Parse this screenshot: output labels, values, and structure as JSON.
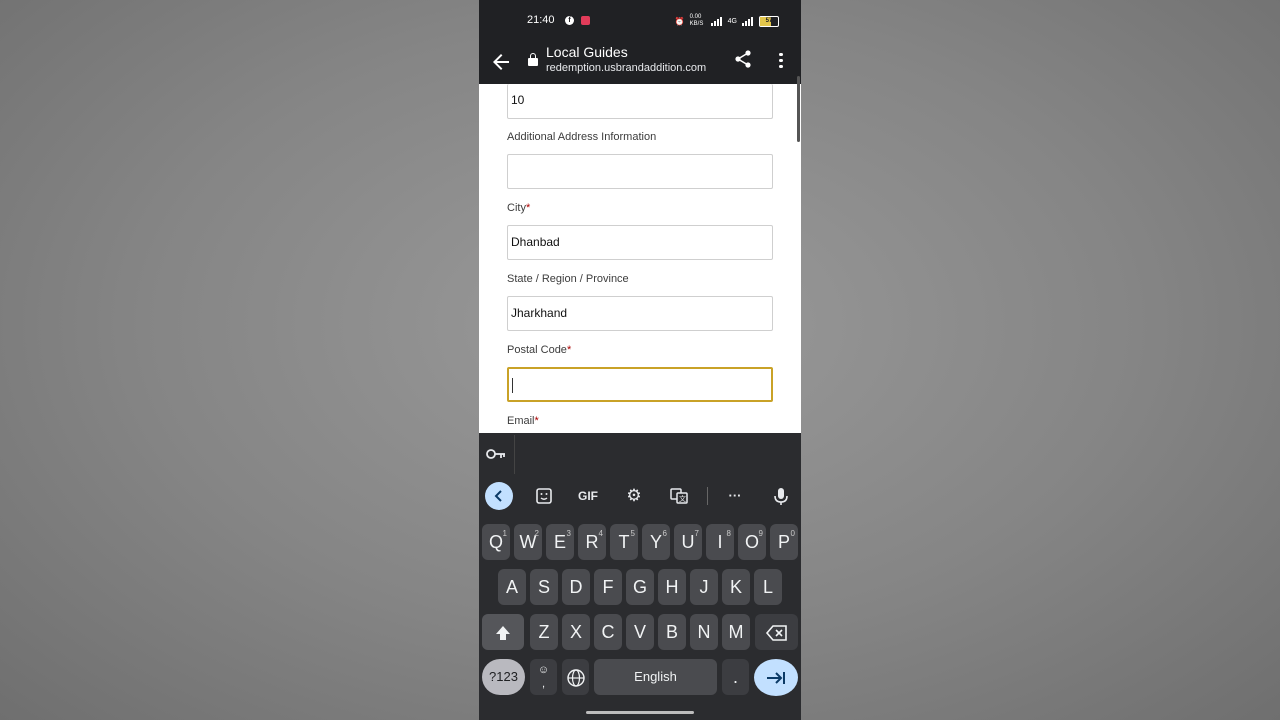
{
  "status_bar": {
    "time": "21:40",
    "network_speed": "0.00 KB/S",
    "network_type": "4G",
    "battery": "57"
  },
  "browser": {
    "title": "Local Guides",
    "url": "redemption.usbrandaddition.com",
    "icons": [
      "back-arrow-icon",
      "lock-icon",
      "share-icon",
      "more-vert-icon"
    ]
  },
  "form": {
    "street_value": "10",
    "additional_label": "Additional Address Information",
    "additional_value": "",
    "city_label": "City",
    "city_value": "Dhanbad",
    "state_label": "State / Region / Province",
    "state_value": "Jharkhand",
    "postal_label": "Postal Code",
    "postal_value": "",
    "email_label": "Email",
    "required_mark": "*",
    "focus_color": "#c9a227"
  },
  "keyboard": {
    "toolbar": {
      "gif": "GIF",
      "more": "···"
    },
    "row1": [
      {
        "k": "Q",
        "n": "1"
      },
      {
        "k": "W",
        "n": "2"
      },
      {
        "k": "E",
        "n": "3"
      },
      {
        "k": "R",
        "n": "4"
      },
      {
        "k": "T",
        "n": "5"
      },
      {
        "k": "Y",
        "n": "6"
      },
      {
        "k": "U",
        "n": "7"
      },
      {
        "k": "I",
        "n": "8"
      },
      {
        "k": "O",
        "n": "9"
      },
      {
        "k": "P",
        "n": "0"
      }
    ],
    "row2": [
      "A",
      "S",
      "D",
      "F",
      "G",
      "H",
      "J",
      "K",
      "L"
    ],
    "row3": [
      "Z",
      "X",
      "C",
      "V",
      "B",
      "N",
      "M"
    ],
    "num_key": "?123",
    "comma_key": ",",
    "emoji_glyph": "☺",
    "space_label": "English",
    "period_key": ".",
    "accent_color": "#c2e0ff"
  }
}
